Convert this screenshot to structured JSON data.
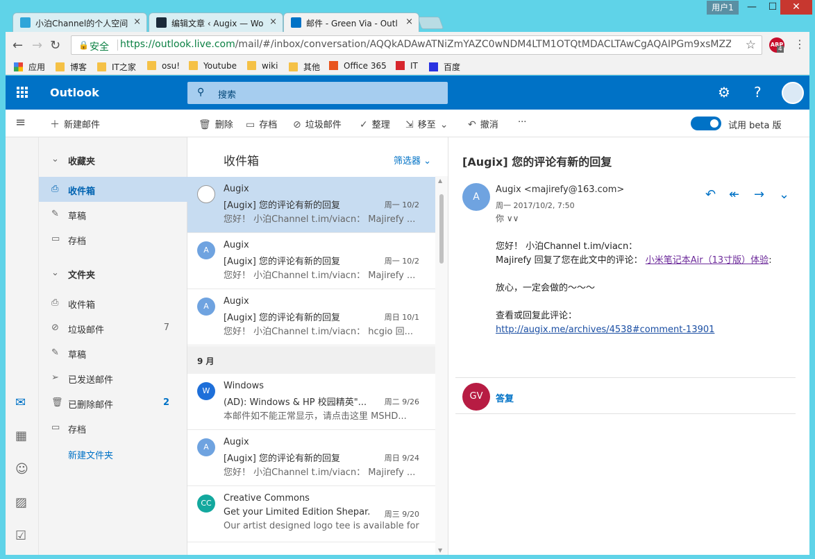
{
  "browser": {
    "tabs": [
      {
        "title": "小泊Channel的个人空间",
        "close": "×"
      },
      {
        "title": "编辑文章 ‹ Augix — Wo",
        "close": "×"
      },
      {
        "title": "邮件 - Green Via - Outl",
        "close": "×"
      }
    ],
    "user_badge": "用户1",
    "window_controls": {
      "minimize": "—",
      "maximize": "☐",
      "close": "✕"
    },
    "secure_label": "安全",
    "url_host": "https://outlook.live.com",
    "url_path": "/mail/#/inbox/conversation/AQQkADAwATNiZmYAZC0wNDM4LTM1OTQtMDACLTAwCgAQAIPGm9xsMZZ...",
    "adblock_label": "ABP",
    "adblock_count": "4",
    "bookmarks": [
      {
        "label": "应用",
        "icon": "apps-grid-icon"
      },
      {
        "label": "博客",
        "icon": "folder-icon"
      },
      {
        "label": "IT之家",
        "icon": "folder-icon"
      },
      {
        "label": "osu!",
        "icon": "folder-icon"
      },
      {
        "label": "Youtube",
        "icon": "folder-icon"
      },
      {
        "label": "wiki",
        "icon": "folder-icon"
      },
      {
        "label": "其他",
        "icon": "folder-icon"
      },
      {
        "label": "Office 365",
        "icon": "office-icon"
      },
      {
        "label": "IT",
        "icon": "it-icon"
      },
      {
        "label": "百度",
        "icon": "baidu-icon"
      }
    ]
  },
  "outlook": {
    "brand": "Outlook",
    "search_placeholder": "搜索",
    "commands": {
      "new_mail": "新建邮件",
      "delete": "删除",
      "archive": "存档",
      "junk": "垃圾邮件",
      "sweep": "整理",
      "move_to": "移至",
      "undo": "撤消",
      "more": "···",
      "beta": "试用 beta 版"
    },
    "folders": {
      "favorites_header": "收藏夹",
      "favorites": [
        {
          "label": "收件箱",
          "icon": "inbox-icon",
          "selected": true
        },
        {
          "label": "草稿",
          "icon": "pencil-icon"
        },
        {
          "label": "存档",
          "icon": "archive-icon"
        }
      ],
      "folders_header": "文件夹",
      "items": [
        {
          "label": "收件箱",
          "icon": "inbox-icon",
          "count": ""
        },
        {
          "label": "垃圾邮件",
          "icon": "block-icon",
          "count": "7"
        },
        {
          "label": "草稿",
          "icon": "pencil-icon",
          "count": ""
        },
        {
          "label": "已发送邮件",
          "icon": "send-icon",
          "count": ""
        },
        {
          "label": "已删除邮件",
          "icon": "trash-icon",
          "count": "2"
        },
        {
          "label": "存档",
          "icon": "archive-icon",
          "count": ""
        }
      ],
      "new_folder": "新建文件夹"
    },
    "list": {
      "title": "收件箱",
      "filter": "筛选器",
      "month_label": "9 月",
      "messages": [
        {
          "from": "Augix",
          "subject": "[Augix] 您的评论有新的回复",
          "date": "周一 10/2",
          "preview": "您好！ 小泊Channel t.im/viacn： Majirefy ...",
          "avatar": "",
          "color": "#ffffff"
        },
        {
          "from": "Augix",
          "subject": "[Augix] 您的评论有新的回复",
          "date": "周一 10/2",
          "preview": "您好！ 小泊Channel t.im/viacn： Majirefy ...",
          "avatar": "A",
          "color": "#6fa3e0"
        },
        {
          "from": "Augix",
          "subject": "[Augix] 您的评论有新的回复",
          "date": "周日 10/1",
          "preview": "您好！ 小泊Channel t.im/viacn： hcgio 回...",
          "avatar": "A",
          "color": "#6fa3e0"
        },
        {
          "from": "Windows",
          "subject": "(AD): Windows & HP 校园精英\"...",
          "date": "周二 9/26",
          "preview": "本邮件如不能正常显示，请点击这里 MSHD...",
          "avatar": "W",
          "color": "#1e6fd9"
        },
        {
          "from": "Augix",
          "subject": "[Augix] 您的评论有新的回复",
          "date": "周日 9/24",
          "preview": "您好！ 小泊Channel t.im/viacn： Majirefy ...",
          "avatar": "A",
          "color": "#6fa3e0"
        },
        {
          "from": "Creative Commons",
          "subject": "Get your Limited Edition Shepar...",
          "date": "周三 9/20",
          "preview": "Our artist designed logo tee is available for ...",
          "avatar": "CC",
          "color": "#13a89e"
        }
      ]
    },
    "reading": {
      "subject": "[Augix] 您的评论有新的回复",
      "avatar": "A",
      "from": "Augix <majirefy@163.com>",
      "date": "周一 2017/10/2, 7:50",
      "to": "你 ∨∨",
      "body_line1": "您好！ 小泊Channel t.im/viacn：",
      "body_line2": "Majirefy 回复了您在此文中的评论：",
      "body_link": "小米笔记本Air（13寸版）体验",
      "body_colon": ":",
      "body_line3": "放心，一定会做的～～～",
      "body_line4": "查看或回复此评论：",
      "comment_link": "http://augix.me/archives/4538#comment-13901",
      "reply_avatar": "GV",
      "reply_label": "答复"
    }
  }
}
